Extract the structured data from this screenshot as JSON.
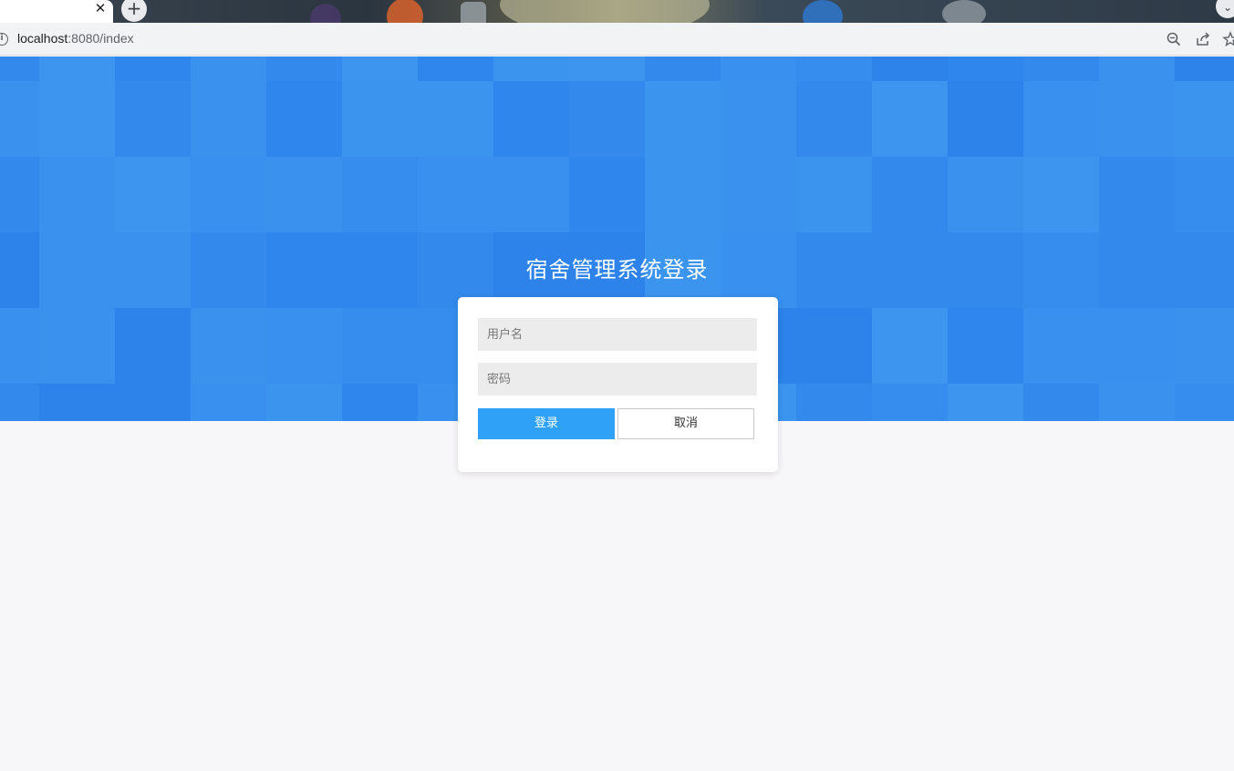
{
  "browser": {
    "tab_close_glyph": "✕",
    "new_tab_glyph": "+",
    "tab_menu_glyph": "⌄",
    "url_host": "localhost",
    "url_path": ":8080/index",
    "info_glyph": "i"
  },
  "login": {
    "title": "宿舍管理系统登录",
    "username_placeholder": "用户名",
    "password_placeholder": "密码",
    "login_label": "登录",
    "cancel_label": "取消"
  },
  "colors": {
    "banner": "#368ded",
    "login_button": "#2fa1f7",
    "page_background": "#f7f6f9"
  }
}
